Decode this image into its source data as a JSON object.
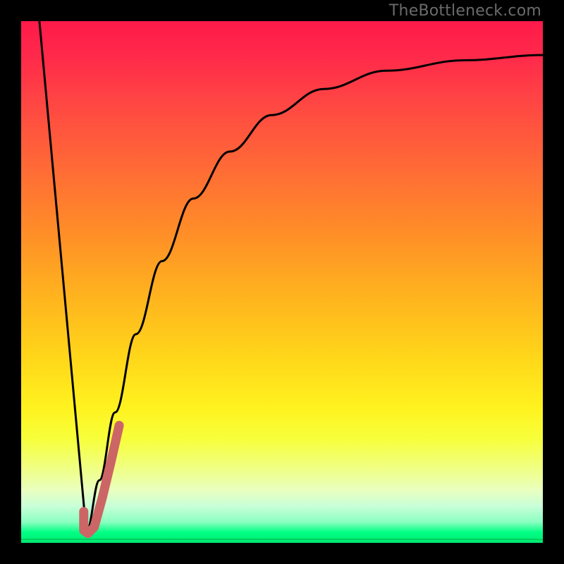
{
  "watermark": "TheBottleneck.com",
  "colors": {
    "background": "#000000",
    "gradient_top": "#ff1a4a",
    "gradient_bottom": "#00e870",
    "curve": "#000000",
    "highlight": "#cc6666",
    "green_line": "#00d060"
  },
  "chart_data": {
    "type": "line",
    "title": "",
    "xlabel": "",
    "ylabel": "",
    "xlim": [
      0,
      1
    ],
    "ylim": [
      0,
      1
    ],
    "series": [
      {
        "name": "left-descent",
        "x": [
          0.035,
          0.125
        ],
        "values": [
          1.0,
          0.02
        ]
      },
      {
        "name": "right-rise",
        "x": [
          0.125,
          0.15,
          0.18,
          0.22,
          0.27,
          0.33,
          0.4,
          0.48,
          0.58,
          0.7,
          0.85,
          1.0
        ],
        "values": [
          0.02,
          0.12,
          0.25,
          0.4,
          0.54,
          0.66,
          0.75,
          0.82,
          0.87,
          0.905,
          0.925,
          0.935
        ]
      },
      {
        "name": "highlight-j",
        "x": [
          0.12,
          0.12,
          0.128,
          0.14,
          0.156,
          0.172,
          0.188
        ],
        "values": [
          0.06,
          0.024,
          0.018,
          0.03,
          0.088,
          0.155,
          0.225
        ]
      }
    ],
    "annotations": [
      {
        "text": "TheBottleneck.com",
        "pos": "top-right"
      }
    ]
  }
}
